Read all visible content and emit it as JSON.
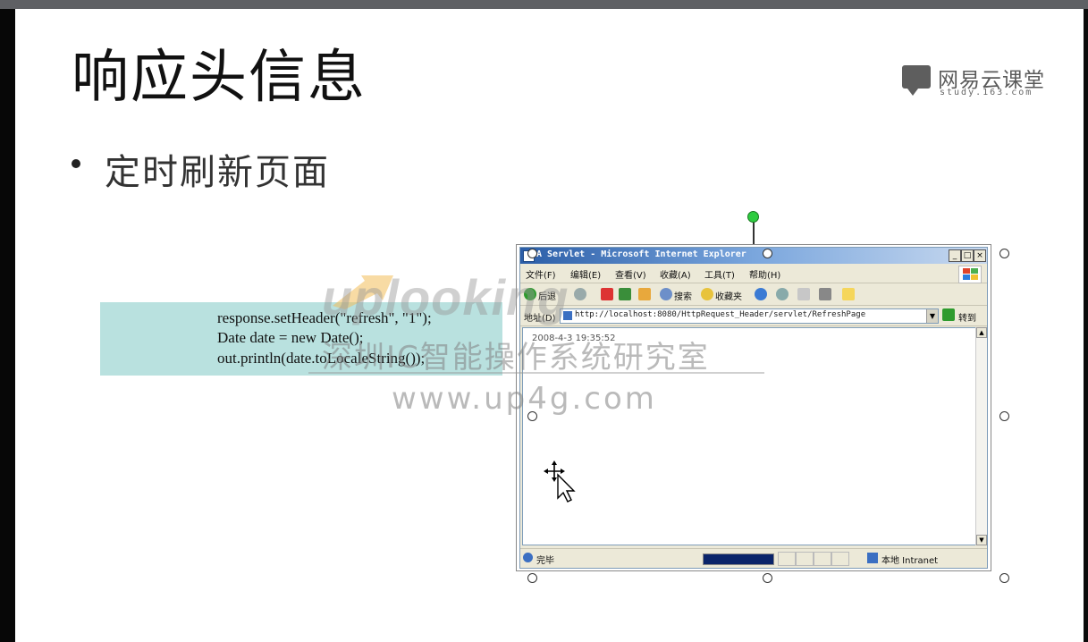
{
  "slide": {
    "title": "响应头信息",
    "bullet": "定时刷新页面",
    "logo": {
      "name": "网易云课堂",
      "sub": "study.163.com"
    },
    "code_lines": [
      "response.setHeader(\"refresh\", \"1\");",
      "Date date  = new Date();",
      "out.println(date.toLocaleString());"
    ]
  },
  "watermark": {
    "brand": "uplooking",
    "cn": "深圳IC智能操作系统研究室",
    "url": "www.up4g.com"
  },
  "ie_window": {
    "title": "A Servlet - Microsoft Internet Explorer",
    "menu": [
      "文件(F)",
      "编辑(E)",
      "查看(V)",
      "收藏(A)",
      "工具(T)",
      "帮助(H)"
    ],
    "toolbar": {
      "back": "后退",
      "search": "搜索",
      "favorites": "收藏夹"
    },
    "address_label": "地址(D)",
    "url": "http://localhost:8080/HttpRequest_Header/servlet/RefreshPage",
    "go_label": "转到",
    "content_text": "2008-4-3 19:35:52",
    "status_text": "完毕",
    "zone_text": "本地 Intranet"
  },
  "colors": {
    "code_bg": "#b9e1df",
    "ie_titlebar": "#2b5ea8",
    "rotate_handle": "#2ecc40"
  }
}
